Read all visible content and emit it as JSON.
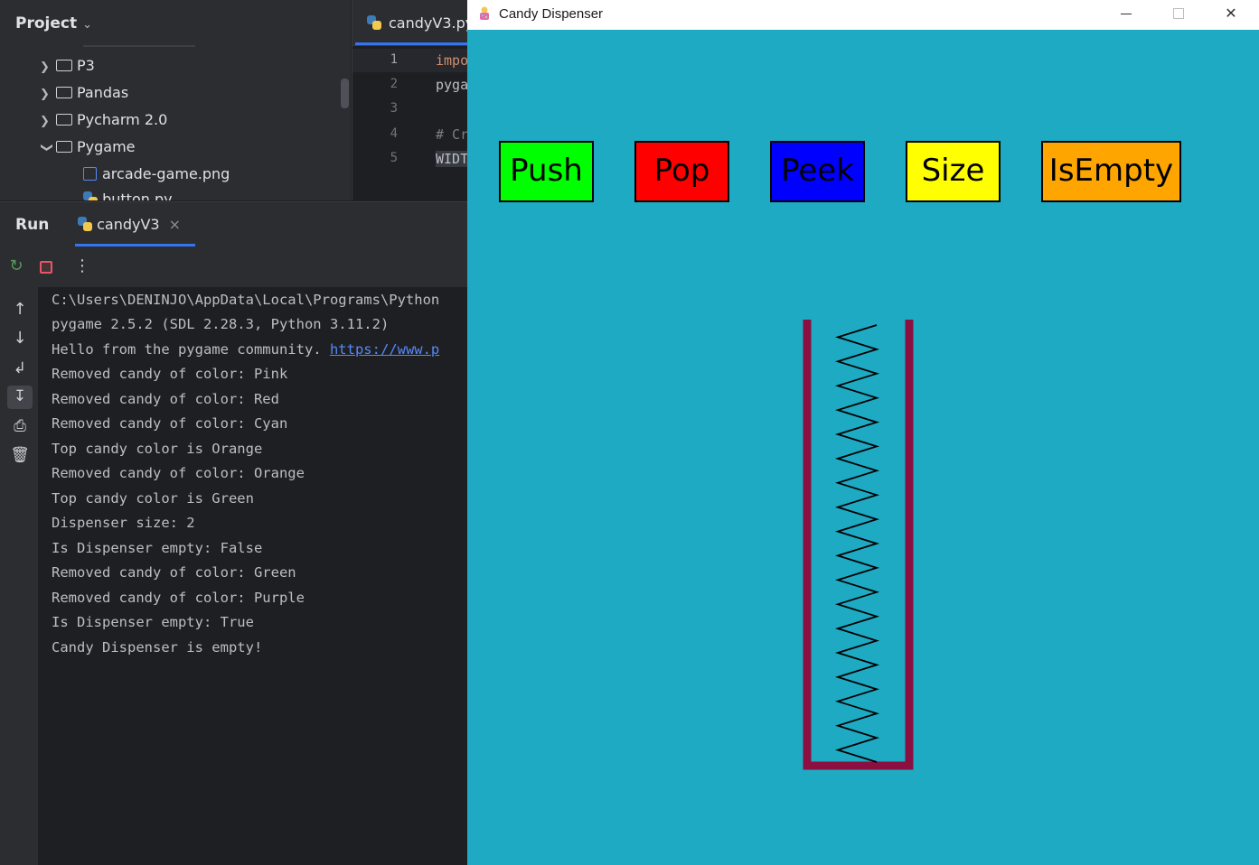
{
  "ide": {
    "project": {
      "title": "Project",
      "tree": [
        {
          "label": "P3",
          "expanded": false,
          "type": "folder"
        },
        {
          "label": "Pandas",
          "expanded": false,
          "type": "folder"
        },
        {
          "label": "Pycharm 2.0",
          "expanded": false,
          "type": "folder"
        },
        {
          "label": "Pygame",
          "expanded": true,
          "type": "folder"
        },
        {
          "label": "arcade-game.png",
          "type": "image-file"
        },
        {
          "label": "button.py",
          "type": "python-file"
        }
      ]
    },
    "editor": {
      "tab_label": "candyV3.py",
      "line_numbers": [
        "1",
        "2",
        "3",
        "4",
        "5"
      ],
      "lines": [
        "impo",
        "pyga",
        "",
        "# Cr",
        "WIDT"
      ]
    },
    "run": {
      "title": "Run",
      "tab_label": "candyV3",
      "console": [
        "C:\\Users\\DENINJO\\AppData\\Local\\Programs\\Python",
        "pygame 2.5.2 (SDL 2.28.3, Python 3.11.2)",
        "Hello from the pygame community. ",
        "Removed candy of color: Pink",
        "Removed candy of color: Red",
        "Removed candy of color: Cyan",
        "Top candy color is Orange",
        "Removed candy of color: Orange",
        "Top candy color is Green",
        "Dispenser size: 2",
        "Is Dispenser empty: False",
        "Removed candy of color: Green",
        "Removed candy of color: Purple",
        "Is Dispenser empty: True",
        "Candy Dispenser is empty!"
      ],
      "console_link": "https://www.p"
    }
  },
  "game": {
    "window_title": "Candy Dispenser",
    "background_color": "#1eaac3",
    "buttons": [
      {
        "label": "Push",
        "color": "#00ff00"
      },
      {
        "label": "Pop",
        "color": "#ff0000"
      },
      {
        "label": "Peek",
        "color": "#0000ff"
      },
      {
        "label": "Size",
        "color": "#ffff00"
      },
      {
        "label": "IsEmpty",
        "color": "#ffa500"
      }
    ],
    "dispenser_color": "#8b0f40",
    "spring_color": "#000000"
  }
}
